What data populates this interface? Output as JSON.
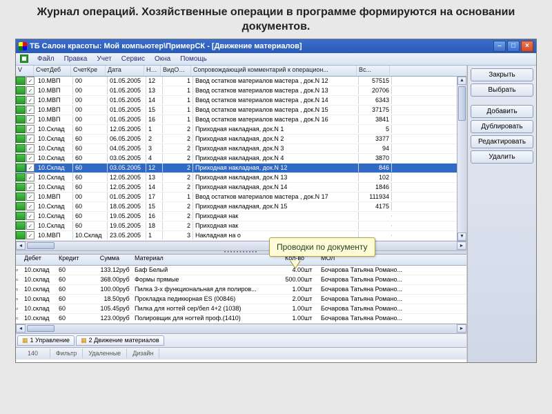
{
  "slide_title": "Журнал операций. Хозяйственные операции в программе формируются на основании документов.",
  "titlebar": {
    "text": "ТБ Салон красоты: Мой компьютер\\ПримерСК - [Движение материалов]"
  },
  "menu": {
    "file": "Файл",
    "edit": "Правка",
    "accounting": "Учет",
    "service": "Сервис",
    "windows": "Окна",
    "help": "Помощь"
  },
  "side_buttons": {
    "close": "Закрыть",
    "select": "Выбрать",
    "add": "Добавить",
    "duplicate": "Дублировать",
    "edit": "Редактировать",
    "delete": "Удалить"
  },
  "grid1": {
    "cols": {
      "v": "V",
      "deb": "СчетДеб",
      "kre": "СчетКре",
      "date": "Дата",
      "no": "Но...",
      "vid": "ВидОпе...",
      "comm": "Сопровождающий комментарий к операцион...",
      "vc": "Вс..."
    },
    "rows": [
      {
        "deb": "10.МВП",
        "kre": "00",
        "date": "01.05.2005",
        "no": "12",
        "vid": "1",
        "comm": "Ввод остатков материалов мастера , док.N 12",
        "vc": "57515"
      },
      {
        "deb": "10.МВП",
        "kre": "00",
        "date": "01.05.2005",
        "no": "13",
        "vid": "1",
        "comm": "Ввод остатков материалов мастера , док.N 13",
        "vc": "20706"
      },
      {
        "deb": "10.МВП",
        "kre": "00",
        "date": "01.05.2005",
        "no": "14",
        "vid": "1",
        "comm": "Ввод остатков материалов мастера , док.N 14",
        "vc": "6343"
      },
      {
        "deb": "10.МВП",
        "kre": "00",
        "date": "01.05.2005",
        "no": "15",
        "vid": "1",
        "comm": "Ввод остатков материалов мастера , док.N 15",
        "vc": "37175"
      },
      {
        "deb": "10.МВП",
        "kre": "00",
        "date": "01.05.2005",
        "no": "16",
        "vid": "1",
        "comm": "Ввод остатков материалов мастера , док.N 16",
        "vc": "3841"
      },
      {
        "deb": "10.Склад",
        "kre": "60",
        "date": "12.05.2005",
        "no": "1",
        "vid": "2",
        "comm": "Приходная накладная, док.N 1",
        "vc": "5"
      },
      {
        "deb": "10.Склад",
        "kre": "60",
        "date": "06.05.2005",
        "no": "2",
        "vid": "2",
        "comm": "Приходная накладная, док.N 2",
        "vc": "3377"
      },
      {
        "deb": "10.Склад",
        "kre": "60",
        "date": "04.05.2005",
        "no": "3",
        "vid": "2",
        "comm": "Приходная накладная, док.N 3",
        "vc": "94"
      },
      {
        "deb": "10.Склад",
        "kre": "60",
        "date": "03.05.2005",
        "no": "4",
        "vid": "2",
        "comm": "Приходная накладная, док.N 4",
        "vc": "3870"
      },
      {
        "deb": "10.Склад",
        "kre": "60",
        "date": "03.05.2005",
        "no": "12",
        "vid": "2",
        "comm": "Приходная накладная, док.N 12",
        "vc": "846",
        "sel": true
      },
      {
        "deb": "10.Склад",
        "kre": "60",
        "date": "12.05.2005",
        "no": "13",
        "vid": "2",
        "comm": "Приходная накладная, док.N 13",
        "vc": "102"
      },
      {
        "deb": "10.Склад",
        "kre": "60",
        "date": "12.05.2005",
        "no": "14",
        "vid": "2",
        "comm": "Приходная накладная, док.N 14",
        "vc": "1846"
      },
      {
        "deb": "10.МВП",
        "kre": "00",
        "date": "01.05.2005",
        "no": "17",
        "vid": "1",
        "comm": "Ввод остатков материалов мастера , док.N 17",
        "vc": "111934"
      },
      {
        "deb": "10.Склад",
        "kre": "60",
        "date": "18.05.2005",
        "no": "15",
        "vid": "2",
        "comm": "Приходная накладная, док.N 15",
        "vc": "4175"
      },
      {
        "deb": "10.Склад",
        "kre": "60",
        "date": "19.05.2005",
        "no": "16",
        "vid": "2",
        "comm": "Приходная нак",
        "vc": ""
      },
      {
        "deb": "10.Склад",
        "kre": "60",
        "date": "19.05.2005",
        "no": "18",
        "vid": "2",
        "comm": "Приходная нак",
        "vc": ""
      },
      {
        "deb": "10.МВП",
        "kre": "10.Склад",
        "date": "23.05.2005",
        "no": "1",
        "vid": "3",
        "comm": "Накладная на о",
        "vc": ""
      }
    ]
  },
  "grid2": {
    "cols": {
      "deb": "Дебет",
      "kre": "Кредит",
      "sum": "Сумма",
      "mat": "Материал",
      "qty": "Кол-во",
      "mol": "МОЛ"
    },
    "rows": [
      {
        "deb": "10.склад",
        "kre": "60",
        "sum": "133.12",
        "cur": "руб",
        "mat": "Баф Белый",
        "qty": "4.00",
        "unit": "шт",
        "mol": "Бочарова Татьяна Романо..."
      },
      {
        "deb": "10.склад",
        "kre": "60",
        "sum": "368.00",
        "cur": "руб",
        "mat": "Формы прямые",
        "qty": "500.00",
        "unit": "шт",
        "mol": "Бочарова Татьяна Романо..."
      },
      {
        "deb": "10.склад",
        "kre": "60",
        "sum": "100.00",
        "cur": "руб",
        "mat": "Пилка 3-х функциональная для полиров...",
        "qty": "1.00",
        "unit": "шт",
        "mol": "Бочарова Татьяна Романо..."
      },
      {
        "deb": "10.склад",
        "kre": "60",
        "sum": "18.50",
        "cur": "руб",
        "mat": "Прокладка педикюрная ES (00846)",
        "qty": "2.00",
        "unit": "шт",
        "mol": "Бочарова Татьяна Романо..."
      },
      {
        "deb": "10.склад",
        "kre": "60",
        "sum": "105.45",
        "cur": "руб",
        "mat": "Пилка для ногтей сер/бел 4+2 (1038)",
        "qty": "1.00",
        "unit": "шт",
        "mol": "Бочарова Татьяна Романо..."
      },
      {
        "deb": "10.склад",
        "kre": "60",
        "sum": "123.00",
        "cur": "руб",
        "mat": "Полировщик для ногтей проф.(1410)",
        "qty": "1.00",
        "unit": "шт",
        "mol": "Бочарова Татьяна Романо..."
      }
    ]
  },
  "tabs": {
    "t1": "1 Управление",
    "t2": "2 Движение материалов"
  },
  "status": {
    "count": "140",
    "filter": "Фильтр",
    "deleted": "Удаленные",
    "design": "Дизайн"
  },
  "callout": {
    "text": "Проводки по документу"
  }
}
